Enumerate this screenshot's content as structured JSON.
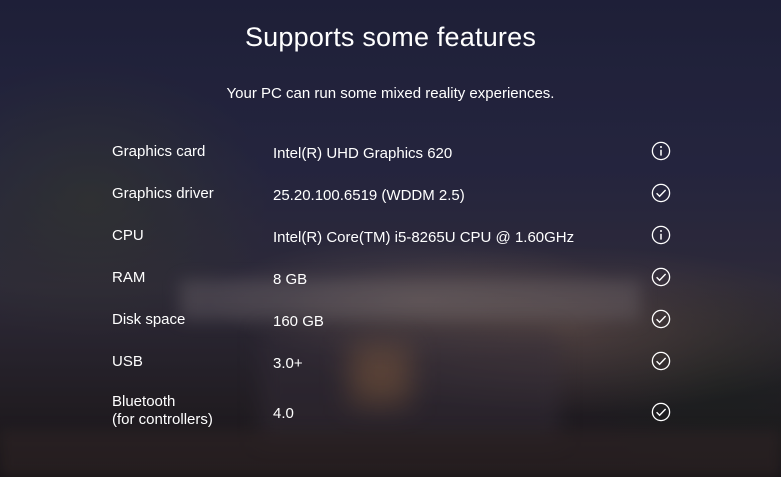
{
  "header": {
    "title": "Supports some features",
    "subtitle": "Your PC can run some mixed reality experiences."
  },
  "requirements": [
    {
      "label": "Graphics card",
      "value": "Intel(R) UHD Graphics 620",
      "status_icon": "info-icon"
    },
    {
      "label": "Graphics driver",
      "value": "25.20.100.6519 (WDDM 2.5)",
      "status_icon": "check-circle-icon"
    },
    {
      "label": "CPU",
      "value": "Intel(R) Core(TM) i5-8265U CPU @ 1.60GHz",
      "status_icon": "info-icon"
    },
    {
      "label": "RAM",
      "value": "8 GB",
      "status_icon": "check-circle-icon"
    },
    {
      "label": "Disk space",
      "value": "160 GB",
      "status_icon": "check-circle-icon"
    },
    {
      "label": "USB",
      "value": "3.0+",
      "status_icon": "check-circle-icon"
    },
    {
      "label": "Bluetooth",
      "label_line2": "(for controllers)",
      "value": "4.0",
      "status_icon": "check-circle-icon"
    }
  ],
  "colors": {
    "text": "#ffffff"
  }
}
